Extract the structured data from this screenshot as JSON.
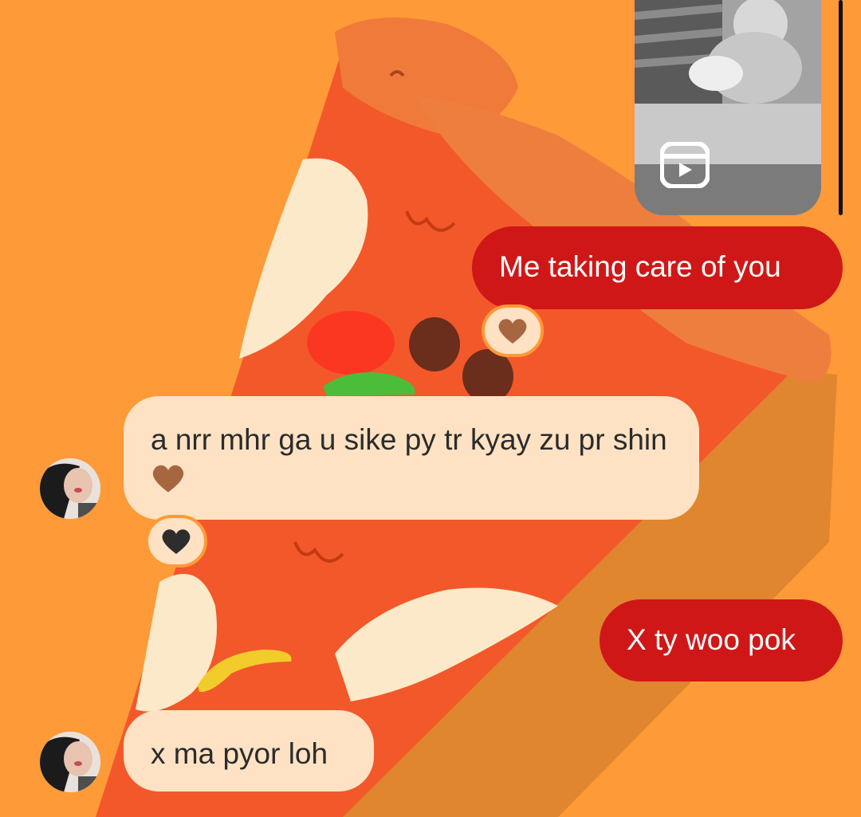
{
  "theme": {
    "background": "#fe9a37",
    "outgoing_bubble": "#d01717",
    "incoming_bubble": "#ffe2c4"
  },
  "shared_media": {
    "type": "reel",
    "icon": "reels-play-icon"
  },
  "messages": [
    {
      "direction": "outgoing",
      "text": "Me taking care of you",
      "reaction": {
        "icon": "brown-heart-icon",
        "color": "#a6663f"
      }
    },
    {
      "direction": "incoming",
      "text": "a nrr mhr ga u sike py tr kyay zu pr shin",
      "emoji": {
        "icon": "brown-heart-icon",
        "color": "#a6663f"
      },
      "reaction": {
        "icon": "black-heart-icon",
        "color": "#2d2d2d"
      }
    },
    {
      "direction": "outgoing",
      "text": "X ty woo pok"
    },
    {
      "direction": "incoming",
      "text": "x ma pyor loh"
    }
  ]
}
